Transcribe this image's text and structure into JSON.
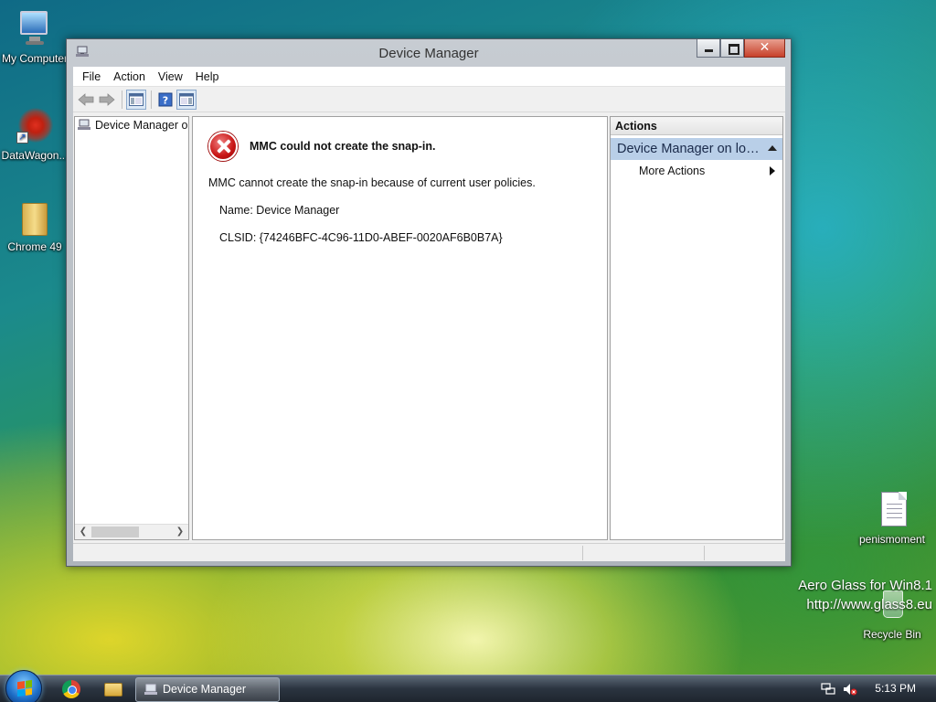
{
  "desktop": {
    "icons": [
      {
        "label": "My Computer"
      },
      {
        "label": "DataWagon..."
      },
      {
        "label": "Chrome 49"
      },
      {
        "label": "penismoment"
      },
      {
        "label": "Recycle Bin"
      }
    ],
    "watermark": {
      "line1": "Aero Glass for Win8.1",
      "line2": "http://www.glass8.eu"
    }
  },
  "window": {
    "title": "Device Manager",
    "menu": [
      "File",
      "Action",
      "View",
      "Help"
    ],
    "tree": {
      "item": "Device Manager on local computer"
    },
    "error": {
      "title": "MMC could not create the snap-in.",
      "message": "MMC cannot create the snap-in because of current user policies.",
      "name": "Name: Device Manager",
      "clsid": "CLSID: {74246BFC-4C96-11D0-ABEF-0020AF6B0B7A}"
    },
    "actions": {
      "header": "Actions",
      "section": "Device Manager on local computer",
      "item": "More Actions"
    }
  },
  "taskbar": {
    "active_task": "Device Manager",
    "clock": "5:13 PM"
  },
  "colors": {
    "actions_section_bg": "#b9cfe8",
    "error_red": "#c81414"
  }
}
